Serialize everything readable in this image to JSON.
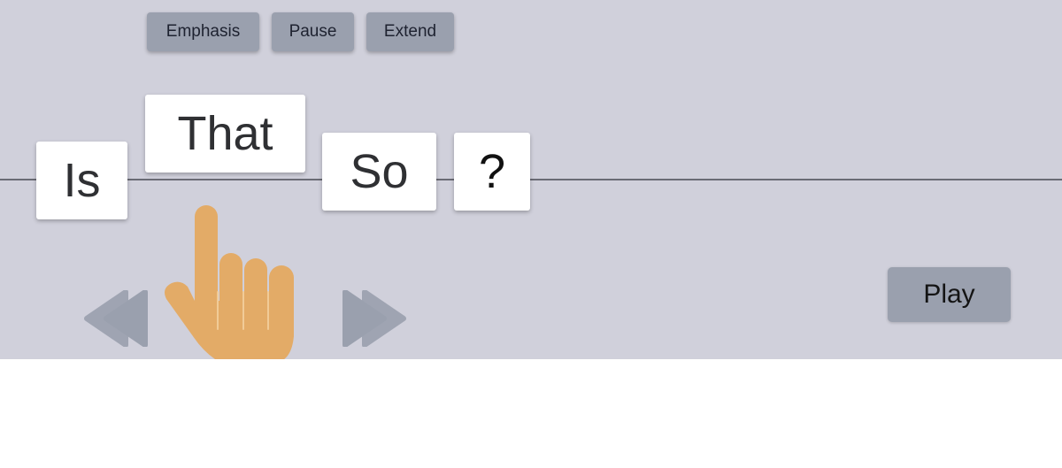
{
  "toolbar": {
    "buttons": [
      {
        "label": "Emphasis"
      },
      {
        "label": "Pause"
      },
      {
        "label": "Extend"
      }
    ]
  },
  "sentence": {
    "words": [
      {
        "text": "Is"
      },
      {
        "text": "That"
      },
      {
        "text": "So"
      },
      {
        "text": "?"
      }
    ]
  },
  "controls": {
    "play_label": "Play",
    "rewind_icon": "rewind-icon",
    "forward_icon": "fast-forward-icon",
    "pointer_icon": "hand-pointer-icon"
  },
  "colors": {
    "panel_background": "#d0d0db",
    "button_fill": "#9aa0ae",
    "hand_color": "#e3ab67",
    "baseline": "#6a6b75"
  }
}
